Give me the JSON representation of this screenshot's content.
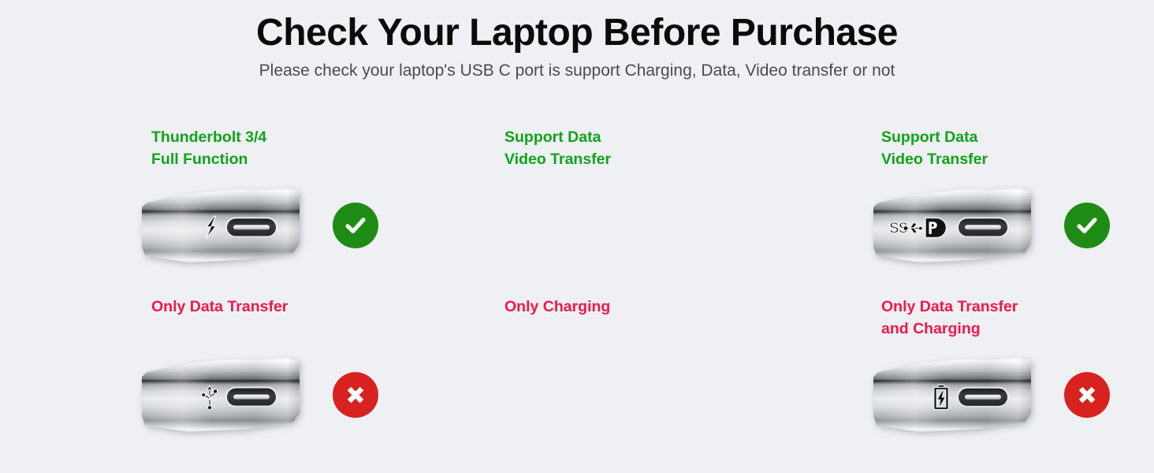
{
  "header": {
    "title": "Check Your Laptop Before Purchase",
    "subtitle": "Please check your laptop's USB C port is support Charging, Data, Video transfer or not"
  },
  "colors": {
    "background": "#eef0f3",
    "title": "#0b0b0b",
    "subtitle": "#4a4a4f",
    "supported_green": "#11a319",
    "unsupported_red": "#f0184a",
    "badge_check_green": "#1e8c14",
    "badge_cross_red": "#d8221f"
  },
  "cards": [
    {
      "label": "Thunderbolt 3/4\nFull Function",
      "status": "supported",
      "badge_icon": "check-circle-icon",
      "port_glyph": "thunderbolt-bolt-icon",
      "port_icon": "usb-c-port-icon"
    },
    {
      "label": "Support Data\nVideo Transfer",
      "status": "supported",
      "badge_icon": "check-circle-icon",
      "port_glyph": "superspeed-usb-displayport-icon",
      "port_icon": "usb-c-port-icon"
    },
    {
      "label": "Support Data\nVideo Transfer",
      "status": "supported",
      "badge_icon": "check-circle-icon",
      "port_glyph": "displayport-icon",
      "port_icon": "usb-c-port-icon"
    },
    {
      "label": "Only Data Transfer",
      "status": "unsupported",
      "badge_icon": "cross-circle-icon",
      "port_glyph": "usb-trident-icon",
      "port_icon": "usb-c-port-icon"
    },
    {
      "label": "Only Charging",
      "status": "unsupported",
      "badge_icon": "cross-circle-icon",
      "port_glyph": "battery-charging-icon",
      "port_icon": "usb-c-port-icon"
    },
    {
      "label": "Only Data Transfer\nand Charging",
      "status": "unsupported",
      "badge_icon": "cross-circle-icon",
      "port_glyph": "superspeed-usb-icon",
      "port_icon": "usb-c-port-icon"
    }
  ]
}
